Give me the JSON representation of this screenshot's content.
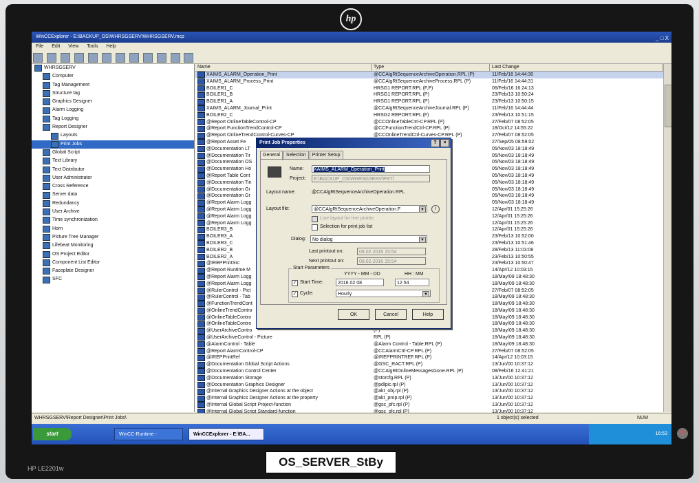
{
  "monitor": {
    "logo": "hp",
    "model": "HP LE2201w",
    "sticker": "OS_SERVER_StBy"
  },
  "window": {
    "title": "WinCCExplorer - E:\\BACKUP_OS\\WHRSGSERV\\WHRSGSERV.mcp",
    "controls": "_ □ X"
  },
  "menu": [
    "File",
    "Edit",
    "View",
    "Tools",
    "Help"
  ],
  "tree": {
    "items": [
      {
        "label": "WHRSGSERV",
        "indent": 0
      },
      {
        "label": "Computer",
        "indent": 1
      },
      {
        "label": "Tag Management",
        "indent": 1
      },
      {
        "label": "Structure tag",
        "indent": 1
      },
      {
        "label": "Graphics Designer",
        "indent": 1
      },
      {
        "label": "Alarm Logging",
        "indent": 1
      },
      {
        "label": "Tag Logging",
        "indent": 1
      },
      {
        "label": "Report Designer",
        "indent": 1
      },
      {
        "label": "Layouts",
        "indent": 2
      },
      {
        "label": "Print Jobs",
        "indent": 2,
        "selected": true
      },
      {
        "label": "Global Script",
        "indent": 1
      },
      {
        "label": "Text Library",
        "indent": 1
      },
      {
        "label": "Text Distributor",
        "indent": 1
      },
      {
        "label": "User Administrator",
        "indent": 1
      },
      {
        "label": "Cross Reference",
        "indent": 1
      },
      {
        "label": "Server data",
        "indent": 1
      },
      {
        "label": "Redundancy",
        "indent": 1
      },
      {
        "label": "User Archive",
        "indent": 1
      },
      {
        "label": "Time synchronization",
        "indent": 1
      },
      {
        "label": "Horn",
        "indent": 1
      },
      {
        "label": "Picture Tree Manager",
        "indent": 1
      },
      {
        "label": "Lifebeat Monitoring",
        "indent": 1
      },
      {
        "label": "OS Project Editor",
        "indent": 1
      },
      {
        "label": "Component List Editor",
        "indent": 1
      },
      {
        "label": "Faceplate Designer",
        "indent": 1
      },
      {
        "label": "SFC",
        "indent": 1
      }
    ]
  },
  "list": {
    "headers": [
      "Name",
      "Type",
      "Last Change"
    ],
    "rows": [
      [
        "XAIMS_ALARM_Operation_Print",
        "@CCAlgRtSequenceArchiveOperation.RPL (P)",
        "11/Feb/16 14:44:30"
      ],
      [
        "XAIMS_ALARM_Process_Print",
        "@CCAlgRtSequenceArchiveProcess.RPL (P)",
        "11/Feb/16 14:44:31"
      ],
      [
        "BOILER1_C",
        "HRSG1 REPORT.RPL (F,P)",
        "06/Feb/16 16:24:13"
      ],
      [
        "BOILER1_B",
        "HRSG1 REPORT.RPL (P)",
        "23/Feb/13 10:50:24"
      ],
      [
        "BOILER1_A",
        "HRSG1 REPORT.RPL (P)",
        "23/Feb/13 10:50:15"
      ],
      [
        "XAIMS_ALARM_Journal_Print",
        "@CCAlgRtSequenceArchiveJournal.RPL (P)",
        "11/Feb/16 14:44:44"
      ],
      [
        "BOILER2_C",
        "HRSG2 REPORT.RPL (F)",
        "23/Feb/13 10:51:15"
      ],
      [
        "@Report OnlineTableControl-CP",
        "@CCOnlineTableCtrl-CP.RPL (P)",
        "27/Feb/07 08:52:05"
      ],
      [
        "@Report FunctionTrendControl-CP",
        "@CCFunctionTrendCtrl-CP.RPL (P)",
        "18/Oct/12 14:55:22"
      ],
      [
        "@Report OnlineTrendControl-Curves-CP",
        "@CCOnlineTrendCtrl-Curves-CP.RPL (P)",
        "27/Feb/07 08:52:05"
      ],
      [
        "@Report Asset Fe",
        "",
        "27/Sep/05 08:59:02"
      ],
      [
        "@Documentation LT",
        "(P)",
        "05/Nov/03 18:18:49"
      ],
      [
        "@Documentation Tir",
        "",
        "05/Nov/03 18:18:49"
      ],
      [
        "@Documentation OS",
        "",
        "05/Nov/03 18:18:49"
      ],
      [
        "@Documentation Ho",
        "",
        "05/Nov/03 18:18:49"
      ],
      [
        "@Report Table Cont",
        "P)",
        "05/Nov/03 18:18:49"
      ],
      [
        "@Documentation Tin",
        "P)",
        "05/Nov/03 18:18:49"
      ],
      [
        "@Documentation Gr",
        "",
        "05/Nov/03 18:18:49"
      ],
      [
        "@Documentation Gr",
        "P)",
        "05/Nov/03 18:18:49"
      ],
      [
        "@Report Alarm Logg",
        "",
        "05/Nov/03 18:18:49"
      ],
      [
        "@Report Alarm Logg",
        "ves.RPL (P)",
        "12/Apr/01 15:25:26"
      ],
      [
        "@Report Alarm Logg",
        "ation.RPL (P)",
        "12/Apr/01 15:25:26"
      ],
      [
        "@Report Alarm Logg",
        "ural.RPL (P)",
        "12/Apr/01 15:25:26"
      ],
      [
        "BOILER3_B",
        "RPL (P)",
        "12/Apr/01 15:25:26"
      ],
      [
        "BOILER3_A",
        "",
        "23/Feb/13 10:52:00"
      ],
      [
        "BOILER3_C",
        "",
        "23/Feb/13 10:51:46"
      ],
      [
        "BOILER2_B",
        "",
        "28/Feb/13 11:03:08"
      ],
      [
        "BOILER2_A",
        "",
        "23/Feb/13 10:50:55"
      ],
      [
        "@IREPPrintSrc",
        "",
        "23/Feb/13 10:50:47"
      ],
      [
        "@Report Runtime M",
        "",
        "14/Apr/12 10:03:15"
      ],
      [
        "@Report Alarm Logg",
        "",
        "18/May/09 18:48:30"
      ],
      [
        "@Report Alarm Logg",
        "RPL (P)",
        "18/May/09 18:48:30"
      ],
      [
        "@RulerControl - Pict",
        "RPL (P)",
        "27/Feb/07 08:52:05"
      ],
      [
        "@RulerControl - Tab",
        "",
        "18/May/09 18:48:30"
      ],
      [
        "@FunctionTrendCont",
        "",
        "18/May/09 18:48:30"
      ],
      [
        "@OnlineTrendContro",
        "e.RPL (P)",
        "18/May/09 18:48:30"
      ],
      [
        "@OnlineTableContro",
        "RPL (P)",
        "18/May/09 18:48:30"
      ],
      [
        "@OnlineTableContro",
        "RPL (P)",
        "18/May/09 18:48:30"
      ],
      [
        "@UserArchiveContro",
        "(P)",
        "18/May/09 18:48:30"
      ],
      [
        "@UserArchiveControl - Picture",
        "RPL (P)",
        "18/May/09 18:48:30"
      ],
      [
        "@AlarmControl - Table",
        "@Alarm Control - Table.RPL (P)",
        "18/May/09 18:48:30"
      ],
      [
        "@Report AlarmControl-CP",
        "@CCAlarmCtrl-CP.RPL (P)",
        "27/Feb/07 08:52:05"
      ],
      [
        "@IREPPrintRef",
        "@IREPPRINTREF.RPL (P)",
        "14/Apr/12 10:03:15"
      ],
      [
        "@Documentation Global Script Actions",
        "@GSC_RACT.RPL (P)",
        "13/Jun/00 10:37:12"
      ],
      [
        "@Documentation Control Center",
        "@CCAlgRtOnlineMessagesGone.RPL (P)",
        "08/Feb/16 12:41:21"
      ],
      [
        "@Documentation Storage",
        "@storcfg.RPL (P)",
        "13/Jun/00 10:37:12"
      ],
      [
        "@Documentation Graphics Designer",
        "@pdlpic.rpl (P)",
        "13/Jun/00 10:37:12"
      ],
      [
        "@Internal Graphics Designer Actions at the object",
        "@akt_obj.rpl (P)",
        "13/Jun/00 10:37:12"
      ],
      [
        "@Internal Graphics Designer Actions at the property",
        "@akt_prop.rpl (P)",
        "13/Jun/00 10:37:12"
      ],
      [
        "@Internal Global Script Project-function",
        "@gsc_pfc.rpl (P)",
        "13/Jun/00 10:37:12"
      ],
      [
        "@Internal Global Script Standard-function",
        "@gsc_sfc.rpl (P)",
        "13/Jun/00 10:37:12"
      ],
      [
        "@Internal Global Script Actions",
        "@gsc_act.rpl (P)",
        "13/Jun/00 10:37:12"
      ]
    ]
  },
  "status": {
    "path": "WHRSGSERV\\Report Designer\\Print Jobs\\",
    "selection": "1 object(s) selected",
    "num": "NUM"
  },
  "taskbar": {
    "start": "start",
    "tasks": [
      "WinCC-Runtime -",
      "WinCCExplorer - E:\\BA..."
    ],
    "clock": "16:53"
  },
  "dialog": {
    "title": "Print Job Properties",
    "tabs": [
      "General",
      "Selection",
      "Printer Setup"
    ],
    "name_label": "Name:",
    "name_value": "XAIMS_ALARM_Operation_Print",
    "project_label": "Project:",
    "project_value": "E:\\BACKUP_OS\\WHRSGSERV\\PRT\\",
    "layout_name_label": "Layout name:",
    "layout_name_value": "@CCAlgRtSequenceArchiveOperation.RPL",
    "layout_file_label": "Layout file:",
    "layout_file_value": "@CCAlgRtSequenceArchiveOperation.F",
    "line_layout_label": "Line layout for line printer",
    "selection_label": "Selection for print job list",
    "dialog_label": "Dialog:",
    "dialog_value": "No dialog",
    "last_printout_label": "Last printout on:",
    "last_printout_value": "08.02.2016  15:54",
    "next_printout_label": "Next printout on:",
    "next_printout_value": "08.02.2016  15:54",
    "start_params_label": "Start Parameters",
    "date_format": "YYYY - MM - DD",
    "time_format": "HH : MM",
    "start_time_label": "Start Time:",
    "start_date_value": "2016  02  08",
    "start_time_value": "12  54",
    "cycle_label": "Cycle:",
    "cycle_value": "Hourly",
    "ok": "OK",
    "cancel": "Cancel",
    "help": "Help"
  }
}
